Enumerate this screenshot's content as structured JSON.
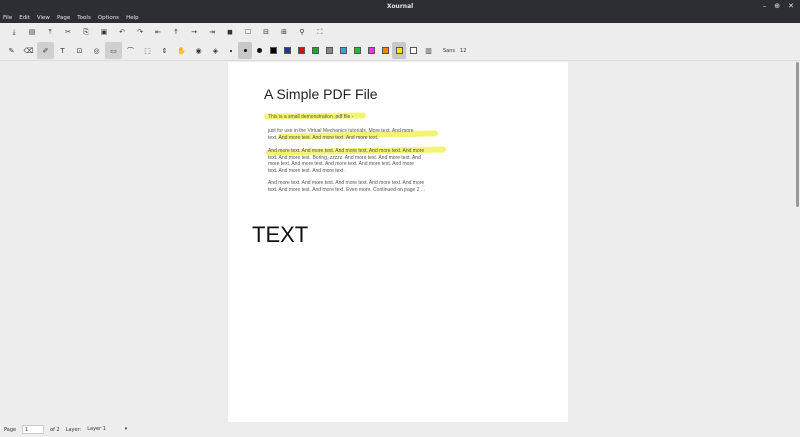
{
  "window": {
    "title": "Xournal",
    "controls": [
      "–",
      "⊕",
      "✕"
    ]
  },
  "menu": [
    "File",
    "Edit",
    "View",
    "Page",
    "Tools",
    "Options",
    "Help"
  ],
  "toolbar1": [
    {
      "name": "save-icon",
      "glyph": "⤓"
    },
    {
      "name": "new-icon",
      "glyph": "▤"
    },
    {
      "name": "open-icon",
      "glyph": "⤒"
    },
    {
      "name": "cut-icon",
      "glyph": "✂"
    },
    {
      "name": "copy-icon",
      "glyph": "⎘"
    },
    {
      "name": "paste-icon",
      "glyph": "▣"
    },
    {
      "name": "undo-icon",
      "glyph": "↶"
    },
    {
      "name": "redo-icon",
      "glyph": "↷"
    },
    {
      "name": "first-page-icon",
      "glyph": "⇤"
    },
    {
      "name": "prev-page-icon",
      "glyph": "↑"
    },
    {
      "name": "next-page-icon",
      "glyph": "→"
    },
    {
      "name": "last-page-icon",
      "glyph": "⇥"
    },
    {
      "name": "new-page-icon",
      "glyph": "◼"
    },
    {
      "name": "zoom-fit-icon",
      "glyph": "☐"
    },
    {
      "name": "zoom-out-icon",
      "glyph": "⊟"
    },
    {
      "name": "zoom-in-icon",
      "glyph": "⊞"
    },
    {
      "name": "search-icon",
      "glyph": "⚲"
    },
    {
      "name": "fullscreen-icon",
      "glyph": "⛶"
    }
  ],
  "toolbar2_tools": [
    {
      "name": "pen-icon",
      "glyph": "✎"
    },
    {
      "name": "eraser-icon",
      "glyph": "⌫"
    },
    {
      "name": "highlighter-icon",
      "glyph": "✐",
      "active": true
    },
    {
      "name": "text-tool-icon",
      "glyph": "T"
    },
    {
      "name": "image-tool-icon",
      "glyph": "⊡"
    },
    {
      "name": "shape-icon",
      "glyph": "◎"
    },
    {
      "name": "ruler-icon",
      "glyph": "▭",
      "active": true
    },
    {
      "name": "lasso-icon",
      "glyph": "⌒"
    },
    {
      "name": "select-rect-icon",
      "glyph": "⬚"
    },
    {
      "name": "vertical-space-icon",
      "glyph": "⇕"
    },
    {
      "name": "hand-icon",
      "glyph": "✋"
    },
    {
      "name": "default-pen-icon",
      "glyph": "◉"
    },
    {
      "name": "default-eraser-icon",
      "glyph": "◈"
    }
  ],
  "thickness": [
    {
      "name": "thin-dot-icon",
      "size": 2
    },
    {
      "name": "medium-dot-icon",
      "size": 3,
      "active": true
    },
    {
      "name": "thick-dot-icon",
      "size": 5
    }
  ],
  "colors": [
    "#000000",
    "#2233aa",
    "#cc1111",
    "#11aa22",
    "#888888",
    "#33aacc",
    "#22bb33",
    "#ee33dd",
    "#ee8800",
    "#f5e400",
    "#ffffff"
  ],
  "active_color_index": 9,
  "toolbar2_extra": {
    "font_label": "Sans",
    "font_size": "12"
  },
  "document": {
    "title": "A Simple PDF File",
    "paragraphs": [
      [
        "This is a small demonstration .pdf file -"
      ],
      [
        "just for use in the Virtual Mechanics tutorials. More text. And more",
        "text. And more text. And more text. And more text."
      ],
      [
        "And more text. And more text. And more text. And more text. And more",
        "text. And more text. Boring, zzzzz. And more text. And more text. And",
        "more text. And more text. And more text. And more text. And more",
        "text. And more text. And more text."
      ],
      [
        "And more text. And more text. And more text. And more text. And more",
        "text. And more text. And more text. Even more. Continued on page 2 ..."
      ]
    ],
    "annotation": "TEXT"
  },
  "status": {
    "page_label": "Page",
    "page_value": "1",
    "page_of": "of 2",
    "layer_label": "Layer:",
    "layer_value": "Layer 1"
  }
}
